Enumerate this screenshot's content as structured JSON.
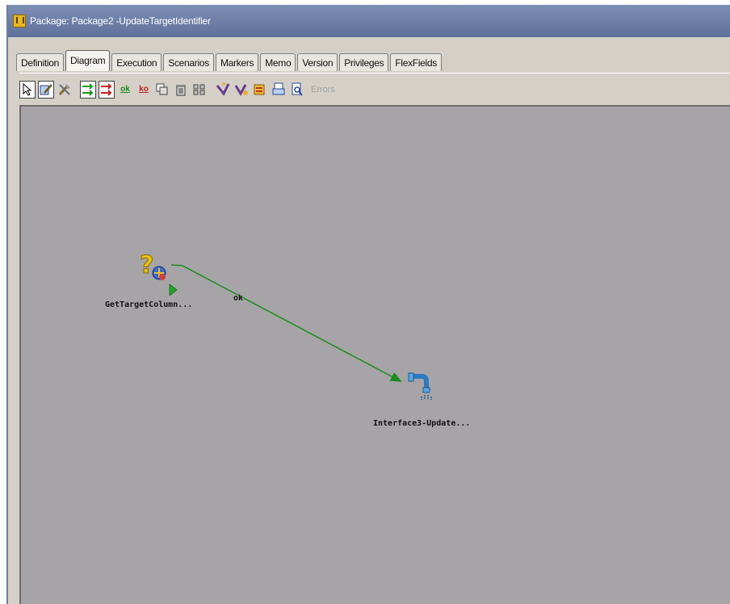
{
  "window": {
    "title": "Package: Package2 -UpdateTargetIdentifier"
  },
  "tabs": [
    {
      "label": "Definition"
    },
    {
      "label": "Diagram"
    },
    {
      "label": "Execution"
    },
    {
      "label": "Scenarios"
    },
    {
      "label": "Markers"
    },
    {
      "label": "Memo"
    },
    {
      "label": "Version"
    },
    {
      "label": "Privileges"
    },
    {
      "label": "FlexFields"
    }
  ],
  "active_tab": "Diagram",
  "toolbar": {
    "ok_label": "ok",
    "ko_label": "ko",
    "errors_label": "Errors",
    "icons": [
      "select-pointer-icon",
      "edit-icon",
      "tools-icon",
      "next-step-ok-icon",
      "next-step-ko-icon",
      "ok-link-icon",
      "ko-link-icon",
      "duplicate-icon",
      "delete-icon",
      "align-icon",
      "execute-icon",
      "execute-step-icon",
      "debug-icon",
      "print-icon",
      "print-preview-icon"
    ]
  },
  "diagram": {
    "nodes": [
      {
        "label": "GetTargetColumn...",
        "icon": "procedure-question-icon",
        "first_step": true
      },
      {
        "label": "Interface3-Update...",
        "icon": "interface-faucet-icon",
        "first_step": false
      }
    ],
    "links": [
      {
        "from": 0,
        "to": 1,
        "label": "ok",
        "color": "#1a8c1a"
      }
    ]
  },
  "colors": {
    "canvas": "#a7a4a7",
    "titlebar": "#6c7fa4",
    "ok_link": "#1a8c1a"
  }
}
